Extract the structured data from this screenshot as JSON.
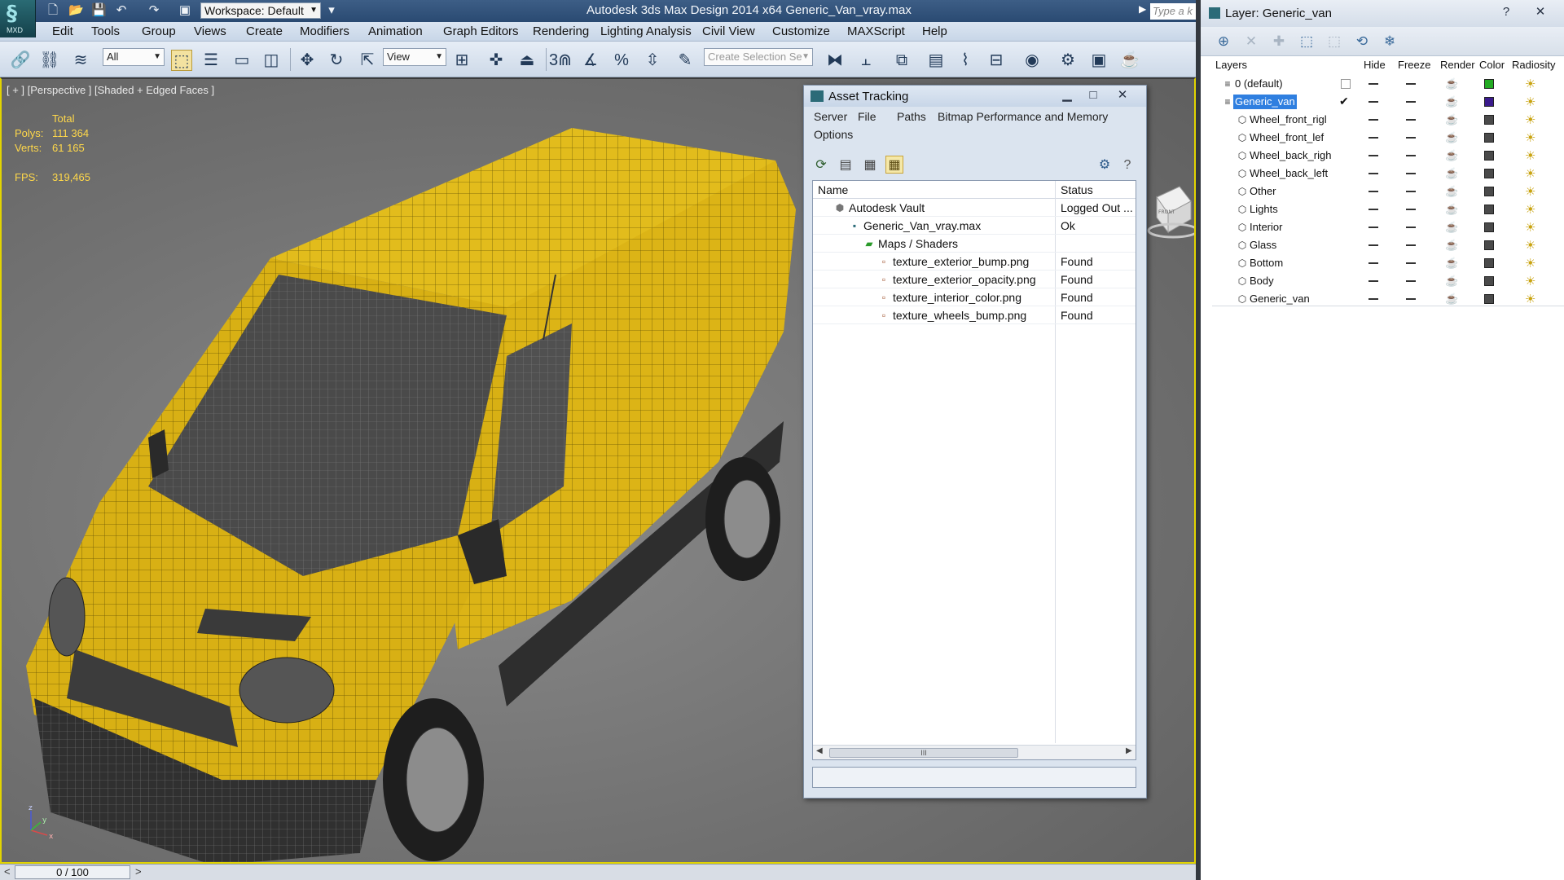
{
  "app": {
    "title": "Autodesk 3ds Max Design 2014 x64      Generic_Van_vray.max",
    "logo_text": "MXD",
    "workspace": "Workspace: Default",
    "search_placeholder": "Type a k"
  },
  "menubar": [
    "Edit",
    "Tools",
    "Group",
    "Views",
    "Create",
    "Modifiers",
    "Animation",
    "Graph Editors",
    "Rendering",
    "Lighting Analysis",
    "Civil View",
    "Customize",
    "MAXScript",
    "Help"
  ],
  "toolbar": {
    "filter": "All",
    "refcoord": "View",
    "selection_set_placeholder": "Create Selection Se",
    "snap_3": "3"
  },
  "viewport": {
    "label": "[ + ] [Perspective ] [Shaded + Edged Faces ]",
    "stats_header": "Total",
    "polys_label": "Polys:",
    "polys_value": "111 364",
    "verts_label": "Verts:",
    "verts_value": "61 165",
    "fps_label": "FPS:",
    "fps_value": "319,465",
    "viewcube_label": "FRONT",
    "axis_x": "x",
    "axis_y": "y",
    "axis_z": "z",
    "border_color": "#e2d400",
    "van_color": "#dcb416"
  },
  "timeline": {
    "frame": "0 / 100",
    "prev": "<",
    "next": ">"
  },
  "asset_tracking": {
    "title": "Asset Tracking",
    "menus": [
      "Server",
      "File",
      "Paths",
      "Bitmap Performance and Memory",
      "Options"
    ],
    "columns": {
      "name": "Name",
      "status": "Status"
    },
    "rows": [
      {
        "name": "Autodesk Vault",
        "status": "Logged Out ..."
      },
      {
        "name": "Generic_Van_vray.max",
        "status": "Ok"
      },
      {
        "name": "Maps / Shaders",
        "status": ""
      },
      {
        "name": "texture_exterior_bump.png",
        "status": "Found"
      },
      {
        "name": "texture_exterior_opacity.png",
        "status": "Found"
      },
      {
        "name": "texture_interior_color.png",
        "status": "Found"
      },
      {
        "name": "texture_wheels_bump.png",
        "status": "Found"
      }
    ],
    "scroll_grip": "III"
  },
  "layers": {
    "title": "Layer: Generic_van",
    "columns": {
      "layers": "Layers",
      "hide": "Hide",
      "freeze": "Freeze",
      "render": "Render",
      "color": "Color",
      "radiosity": "Radiosity"
    },
    "items": [
      {
        "name": "0 (default)",
        "color": "#22aa22"
      },
      {
        "name": "Generic_van",
        "color": "#3a1a8c"
      },
      {
        "name": "Wheel_front_rigl",
        "color": "#4a4a4a"
      },
      {
        "name": "Wheel_front_lef",
        "color": "#4a4a4a"
      },
      {
        "name": "Wheel_back_righ",
        "color": "#4a4a4a"
      },
      {
        "name": "Wheel_back_left",
        "color": "#4a4a4a"
      },
      {
        "name": "Other",
        "color": "#4a4a4a"
      },
      {
        "name": "Lights",
        "color": "#4a4a4a"
      },
      {
        "name": "Interior",
        "color": "#4a4a4a"
      },
      {
        "name": "Glass",
        "color": "#4a4a4a"
      },
      {
        "name": "Bottom",
        "color": "#4a4a4a"
      },
      {
        "name": "Body",
        "color": "#4a4a4a"
      },
      {
        "name": "Generic_van",
        "color": "#4a4a4a"
      }
    ],
    "selected_color": "#2f7fe0"
  }
}
